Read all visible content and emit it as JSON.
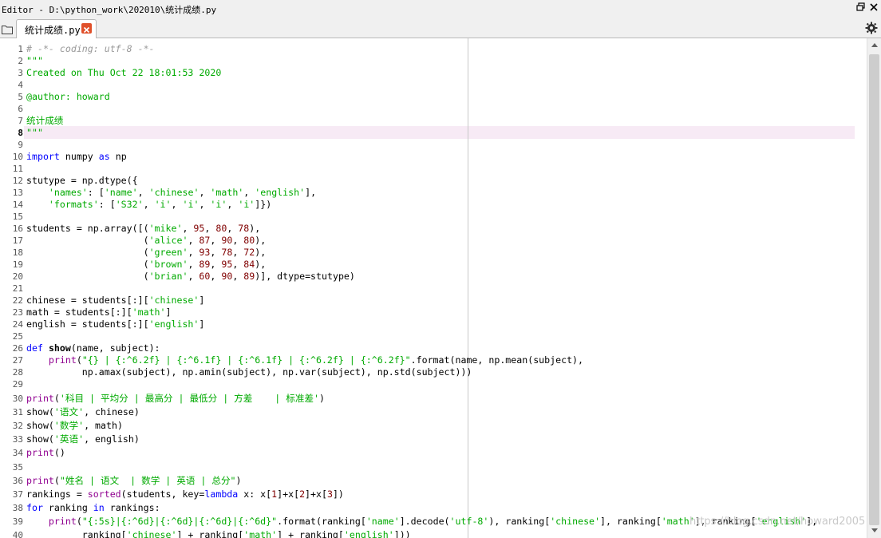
{
  "window": {
    "title": "Editor - D:\\python_work\\202010\\统计成绩.py"
  },
  "tabs": [
    {
      "label": "统计成绩.py",
      "active": true
    }
  ],
  "editor": {
    "current_line": 8,
    "lines": [
      {
        "n": "1",
        "tokens": [
          {
            "t": "comment",
            "v": "# -*- coding: utf-8 -*-"
          }
        ]
      },
      {
        "n": "2",
        "tokens": [
          {
            "t": "doc",
            "v": "\"\"\""
          }
        ]
      },
      {
        "n": "3",
        "tokens": [
          {
            "t": "doc",
            "v": "Created on Thu Oct 22 18:01:53 2020"
          }
        ]
      },
      {
        "n": "4",
        "tokens": []
      },
      {
        "n": "5",
        "tokens": [
          {
            "t": "doc",
            "v": "@author: howard"
          }
        ]
      },
      {
        "n": "6",
        "tokens": []
      },
      {
        "n": "7",
        "tokens": [
          {
            "t": "doc",
            "v": "统计成绩"
          }
        ]
      },
      {
        "n": "8",
        "tokens": [
          {
            "t": "doc",
            "v": "\"\"\""
          }
        ]
      },
      {
        "n": "9",
        "tokens": []
      },
      {
        "n": "10",
        "tokens": [
          {
            "t": "kw",
            "v": "import"
          },
          {
            "t": "plain",
            "v": " numpy "
          },
          {
            "t": "kw",
            "v": "as"
          },
          {
            "t": "plain",
            "v": " np"
          }
        ]
      },
      {
        "n": "11",
        "tokens": []
      },
      {
        "n": "12",
        "tokens": [
          {
            "t": "plain",
            "v": "stutype = np.dtype({"
          }
        ]
      },
      {
        "n": "13",
        "tokens": [
          {
            "t": "plain",
            "v": "    "
          },
          {
            "t": "str",
            "v": "'names'"
          },
          {
            "t": "plain",
            "v": ": ["
          },
          {
            "t": "str",
            "v": "'name'"
          },
          {
            "t": "plain",
            "v": ", "
          },
          {
            "t": "str",
            "v": "'chinese'"
          },
          {
            "t": "plain",
            "v": ", "
          },
          {
            "t": "str",
            "v": "'math'"
          },
          {
            "t": "plain",
            "v": ", "
          },
          {
            "t": "str",
            "v": "'english'"
          },
          {
            "t": "plain",
            "v": "],"
          }
        ]
      },
      {
        "n": "14",
        "tokens": [
          {
            "t": "plain",
            "v": "    "
          },
          {
            "t": "str",
            "v": "'formats'"
          },
          {
            "t": "plain",
            "v": ": ["
          },
          {
            "t": "str",
            "v": "'S32'"
          },
          {
            "t": "plain",
            "v": ", "
          },
          {
            "t": "str",
            "v": "'i'"
          },
          {
            "t": "plain",
            "v": ", "
          },
          {
            "t": "str",
            "v": "'i'"
          },
          {
            "t": "plain",
            "v": ", "
          },
          {
            "t": "str",
            "v": "'i'"
          },
          {
            "t": "plain",
            "v": ", "
          },
          {
            "t": "str",
            "v": "'i'"
          },
          {
            "t": "plain",
            "v": "]})"
          }
        ]
      },
      {
        "n": "15",
        "tokens": []
      },
      {
        "n": "16",
        "tokens": [
          {
            "t": "plain",
            "v": "students = np.array([("
          },
          {
            "t": "str",
            "v": "'mike'"
          },
          {
            "t": "plain",
            "v": ", "
          },
          {
            "t": "num",
            "v": "95"
          },
          {
            "t": "plain",
            "v": ", "
          },
          {
            "t": "num",
            "v": "80"
          },
          {
            "t": "plain",
            "v": ", "
          },
          {
            "t": "num",
            "v": "78"
          },
          {
            "t": "plain",
            "v": "),"
          }
        ]
      },
      {
        "n": "17",
        "tokens": [
          {
            "t": "plain",
            "v": "                     ("
          },
          {
            "t": "str",
            "v": "'alice'"
          },
          {
            "t": "plain",
            "v": ", "
          },
          {
            "t": "num",
            "v": "87"
          },
          {
            "t": "plain",
            "v": ", "
          },
          {
            "t": "num",
            "v": "90"
          },
          {
            "t": "plain",
            "v": ", "
          },
          {
            "t": "num",
            "v": "80"
          },
          {
            "t": "plain",
            "v": "),"
          }
        ]
      },
      {
        "n": "18",
        "tokens": [
          {
            "t": "plain",
            "v": "                     ("
          },
          {
            "t": "str",
            "v": "'green'"
          },
          {
            "t": "plain",
            "v": ", "
          },
          {
            "t": "num",
            "v": "93"
          },
          {
            "t": "plain",
            "v": ", "
          },
          {
            "t": "num",
            "v": "78"
          },
          {
            "t": "plain",
            "v": ", "
          },
          {
            "t": "num",
            "v": "72"
          },
          {
            "t": "plain",
            "v": "),"
          }
        ]
      },
      {
        "n": "19",
        "tokens": [
          {
            "t": "plain",
            "v": "                     ("
          },
          {
            "t": "str",
            "v": "'brown'"
          },
          {
            "t": "plain",
            "v": ", "
          },
          {
            "t": "num",
            "v": "89"
          },
          {
            "t": "plain",
            "v": ", "
          },
          {
            "t": "num",
            "v": "95"
          },
          {
            "t": "plain",
            "v": ", "
          },
          {
            "t": "num",
            "v": "84"
          },
          {
            "t": "plain",
            "v": "),"
          }
        ]
      },
      {
        "n": "20",
        "tokens": [
          {
            "t": "plain",
            "v": "                     ("
          },
          {
            "t": "str",
            "v": "'brian'"
          },
          {
            "t": "plain",
            "v": ", "
          },
          {
            "t": "num",
            "v": "60"
          },
          {
            "t": "plain",
            "v": ", "
          },
          {
            "t": "num",
            "v": "90"
          },
          {
            "t": "plain",
            "v": ", "
          },
          {
            "t": "num",
            "v": "89"
          },
          {
            "t": "plain",
            "v": ")], dtype=stutype)"
          }
        ]
      },
      {
        "n": "21",
        "tokens": []
      },
      {
        "n": "22",
        "tokens": [
          {
            "t": "plain",
            "v": "chinese = students[:]["
          },
          {
            "t": "str",
            "v": "'chinese'"
          },
          {
            "t": "plain",
            "v": "]"
          }
        ]
      },
      {
        "n": "23",
        "tokens": [
          {
            "t": "plain",
            "v": "math = students[:]["
          },
          {
            "t": "str",
            "v": "'math'"
          },
          {
            "t": "plain",
            "v": "]"
          }
        ]
      },
      {
        "n": "24",
        "tokens": [
          {
            "t": "plain",
            "v": "english = students[:]["
          },
          {
            "t": "str",
            "v": "'english'"
          },
          {
            "t": "plain",
            "v": "]"
          }
        ]
      },
      {
        "n": "25",
        "tokens": []
      },
      {
        "n": "26",
        "tokens": [
          {
            "t": "def",
            "v": "def"
          },
          {
            "t": "plain",
            "v": " "
          },
          {
            "t": "fn",
            "v": "show"
          },
          {
            "t": "plain",
            "v": "(name, subject):"
          }
        ]
      },
      {
        "n": "27",
        "tokens": [
          {
            "t": "plain",
            "v": "    "
          },
          {
            "t": "builtin",
            "v": "print"
          },
          {
            "t": "plain",
            "v": "("
          },
          {
            "t": "str",
            "v": "\"{} | {:^6.2f} | {:^6.1f} | {:^6.1f} | {:^6.2f} | {:^6.2f}\""
          },
          {
            "t": "plain",
            "v": ".format(name, np.mean(subject),"
          }
        ]
      },
      {
        "n": "28",
        "tokens": [
          {
            "t": "plain",
            "v": "          np.amax(subject), np.amin(subject), np.var(subject), np.std(subject)))"
          }
        ]
      },
      {
        "n": "29",
        "tokens": []
      },
      {
        "n": "30",
        "tokens": [
          {
            "t": "builtin",
            "v": "print"
          },
          {
            "t": "plain",
            "v": "("
          },
          {
            "t": "str",
            "v": "'科目 | 平均分 | 最高分 | 最低分 | 方差    | 标准差'"
          },
          {
            "t": "plain",
            "v": ")"
          }
        ]
      },
      {
        "n": "31",
        "tokens": [
          {
            "t": "plain",
            "v": "show("
          },
          {
            "t": "str",
            "v": "'语文'"
          },
          {
            "t": "plain",
            "v": ", chinese)"
          }
        ]
      },
      {
        "n": "32",
        "tokens": [
          {
            "t": "plain",
            "v": "show("
          },
          {
            "t": "str",
            "v": "'数学'"
          },
          {
            "t": "plain",
            "v": ", math)"
          }
        ]
      },
      {
        "n": "33",
        "tokens": [
          {
            "t": "plain",
            "v": "show("
          },
          {
            "t": "str",
            "v": "'英语'"
          },
          {
            "t": "plain",
            "v": ", english)"
          }
        ]
      },
      {
        "n": "34",
        "tokens": [
          {
            "t": "builtin",
            "v": "print"
          },
          {
            "t": "plain",
            "v": "()"
          }
        ]
      },
      {
        "n": "35",
        "tokens": []
      },
      {
        "n": "36",
        "tokens": [
          {
            "t": "builtin",
            "v": "print"
          },
          {
            "t": "plain",
            "v": "("
          },
          {
            "t": "str",
            "v": "\"姓名 | 语文  | 数学 | 英语 | 总分\""
          },
          {
            "t": "plain",
            "v": ")"
          }
        ]
      },
      {
        "n": "37",
        "tokens": [
          {
            "t": "plain",
            "v": "rankings = "
          },
          {
            "t": "builtin",
            "v": "sorted"
          },
          {
            "t": "plain",
            "v": "(students, key="
          },
          {
            "t": "kw",
            "v": "lambda"
          },
          {
            "t": "plain",
            "v": " x: x["
          },
          {
            "t": "num",
            "v": "1"
          },
          {
            "t": "plain",
            "v": "]+x["
          },
          {
            "t": "num",
            "v": "2"
          },
          {
            "t": "plain",
            "v": "]+x["
          },
          {
            "t": "num",
            "v": "3"
          },
          {
            "t": "plain",
            "v": "])"
          }
        ]
      },
      {
        "n": "38",
        "tokens": [
          {
            "t": "kw",
            "v": "for"
          },
          {
            "t": "plain",
            "v": " ranking "
          },
          {
            "t": "kw",
            "v": "in"
          },
          {
            "t": "plain",
            "v": " rankings:"
          }
        ]
      },
      {
        "n": "39",
        "tokens": [
          {
            "t": "plain",
            "v": "    "
          },
          {
            "t": "builtin",
            "v": "print"
          },
          {
            "t": "plain",
            "v": "("
          },
          {
            "t": "str",
            "v": "\"{:5s}|{:^6d}|{:^6d}|{:^6d}|{:^6d}\""
          },
          {
            "t": "plain",
            "v": ".format(ranking["
          },
          {
            "t": "str",
            "v": "'name'"
          },
          {
            "t": "plain",
            "v": "].decode("
          },
          {
            "t": "str",
            "v": "'utf-8'"
          },
          {
            "t": "plain",
            "v": "), ranking["
          },
          {
            "t": "str",
            "v": "'chinese'"
          },
          {
            "t": "plain",
            "v": "], ranking["
          },
          {
            "t": "str",
            "v": "'math'"
          },
          {
            "t": "plain",
            "v": "], ranking["
          },
          {
            "t": "str",
            "v": "'english'"
          },
          {
            "t": "plain",
            "v": "],"
          }
        ]
      },
      {
        "n": "40",
        "tokens": [
          {
            "t": "plain",
            "v": "          ranking["
          },
          {
            "t": "str",
            "v": "'chinese'"
          },
          {
            "t": "plain",
            "v": "] + ranking["
          },
          {
            "t": "str",
            "v": "'math'"
          },
          {
            "t": "plain",
            "v": "] + ranking["
          },
          {
            "t": "str",
            "v": "'english'"
          },
          {
            "t": "plain",
            "v": "]))"
          }
        ]
      }
    ]
  },
  "watermark": "https://blog.csdn.net/howard2005",
  "icons": {
    "folder": "folder-icon",
    "close_tab": "close-icon",
    "settings": "gear-icon",
    "restore": "restore-window-icon",
    "close_window": "close-window-icon"
  },
  "colors": {
    "string": "#00aa00",
    "keyword": "#0000ff",
    "number": "#800000",
    "builtin": "#900090",
    "comment": "#999999",
    "current_line": "#f7eaf5",
    "tab_close": "#e0502a"
  }
}
